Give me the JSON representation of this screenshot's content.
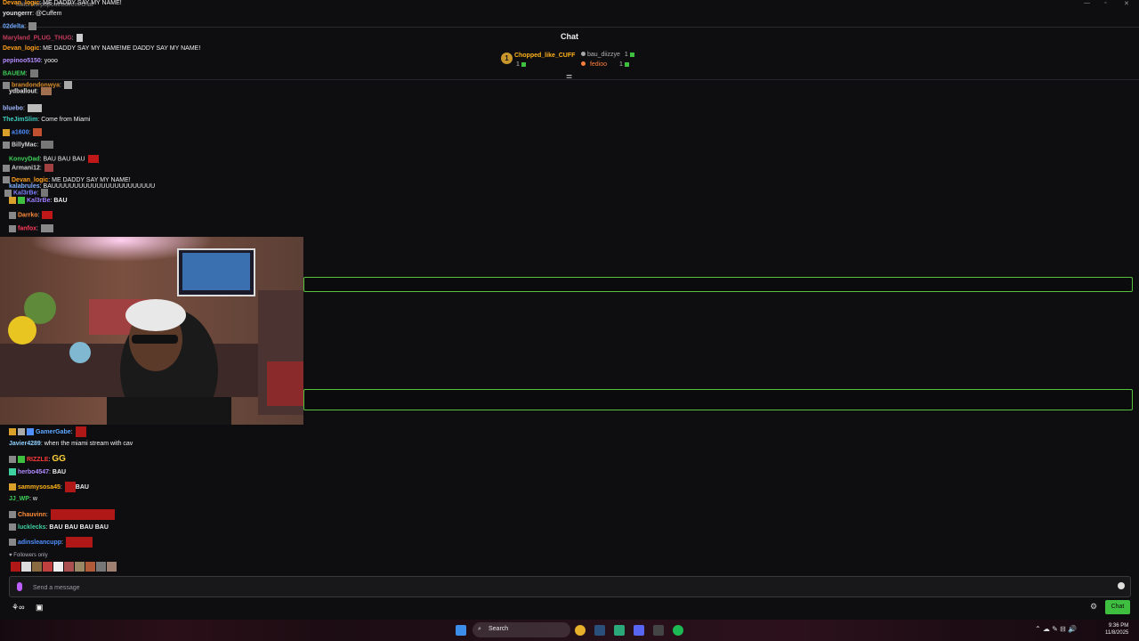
{
  "browser": {
    "url": "twitch.tv/popout/cuffem/chat"
  },
  "chat_header": {
    "title": "Chat"
  },
  "leaderboard": {
    "items": [
      {
        "rank": "1",
        "name": "Chopped_like_CUFF",
        "count": "1",
        "color": "#ffb31a"
      },
      {
        "name": "bau_diizzye",
        "count": "1",
        "color": "#b0b0b0"
      },
      {
        "name": "fedioo",
        "count": "1",
        "color": "#ff7f3a"
      }
    ]
  },
  "overlay_messages": [
    {
      "user": "Devan_logic",
      "text": "ME DADDY SAY MY NAME!",
      "color": "#ff9f1c"
    },
    {
      "user": "youngerrr",
      "text": "@Cuffem",
      "color": "#e0e0e0"
    },
    {
      "user": "02delta",
      "text": "",
      "color": "#6fa8ff"
    },
    {
      "user": "Maryland_PLUG_THUG",
      "text": "",
      "color": "#c43a5a"
    },
    {
      "user": "Devan_logic",
      "text": "ME DADDY SAY MY NAME!ME DADDY SAY MY NAME!",
      "color": "#ff9f1c"
    },
    {
      "user": "pepinoo5150",
      "text": "yooo",
      "color": "#b48cff"
    },
    {
      "user": "BAUEM",
      "text": "",
      "color": "#3fd05a"
    },
    {
      "user": "brandondonwya",
      "text": "",
      "color": "#d98c2a"
    },
    {
      "user": "ydballout",
      "text": "",
      "color": "#e0e0e0"
    },
    {
      "user": "bluebo",
      "text": "",
      "color": "#9fb6ff"
    },
    {
      "user": "TheJimSlim",
      "text": "Come from Miami",
      "color": "#3fd0c0"
    },
    {
      "user": "a1600",
      "text": "",
      "color": "#4f8fff"
    },
    {
      "user": "BillyMac",
      "text": "",
      "color": "#d0d0d0"
    },
    {
      "user": "KonvyDad",
      "text": "BAU BAU BAU",
      "color": "#3fd05a"
    },
    {
      "user": "Armani12",
      "text": "",
      "color": "#d0d0d0"
    },
    {
      "user": "Devan_logic",
      "text": "ME DADDY SAY MY NAME!",
      "color": "#ff9f1c"
    },
    {
      "user": "kalabrules",
      "text": "BAUUUUUUUUUUUUUUUUUUUUUUU",
      "color": "#7fb0ff"
    },
    {
      "user": "Kal3rBe",
      "text": "",
      "color": "#7f7fff"
    },
    {
      "user": "Kal3rBe",
      "text": "BAU",
      "color": "#9f7fff"
    },
    {
      "user": "Darrko",
      "text": "",
      "color": "#ff8c3a"
    },
    {
      "user": "fanfox",
      "text": "",
      "color": "#ff3a5a"
    }
  ],
  "chat_messages": [
    {
      "user": "GamerGabe",
      "text": "",
      "color": "#5fa8ff"
    },
    {
      "user": "Javier4289",
      "text": "when the miami stream with cav",
      "color": "#8fd0ff"
    },
    {
      "user": "RIZZLE",
      "text": "GG",
      "color": "#ff3a3a"
    },
    {
      "user": "herbo4547",
      "text": "BAU",
      "color": "#b08cff"
    },
    {
      "user": "sammysosa45",
      "text": "BAU",
      "color": "#ffb31a"
    },
    {
      "user": "JJ_WP",
      "text": "w",
      "color": "#3fd05a"
    },
    {
      "user": "Chauvinn",
      "text": "",
      "color": "#ff8c3a"
    },
    {
      "user": "lucklecks",
      "text": "BAU BAU BAU BAU",
      "color": "#3fd0a0"
    },
    {
      "user": "adinsleancupp",
      "text": "",
      "color": "#4f8fff"
    }
  ],
  "followers_only": "Followers only",
  "input": {
    "placeholder": "Send a message"
  },
  "bottom": {
    "chat_button": "Chat",
    "points": "∞"
  },
  "taskbar": {
    "search": "Search",
    "time": "9:36 PM",
    "date": "11/8/2025"
  }
}
